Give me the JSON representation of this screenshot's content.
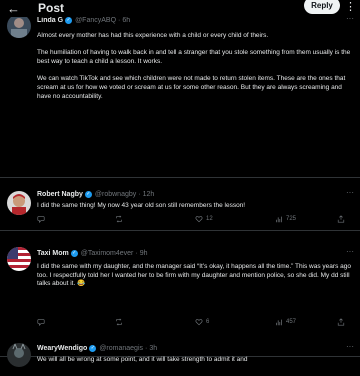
{
  "header": {
    "back_icon": "arrow-left-icon",
    "title": "Post",
    "reply_label": "Reply",
    "more_icon": "more-vertical-icon"
  },
  "posts": [
    {
      "name": "Linda G",
      "handle": "@FancyABQ",
      "time": "6h",
      "verified": true,
      "paragraphs": [
        "Almost every mother has had this experience with a child or every child of theirs.",
        "The humiliation of having to walk back in and tell a stranger that you stole something from them usually is the best way to teach a child a lesson. It works.",
        "We can watch TikTok and see which children were not made to return stolen items. These are the ones that scream at us for how we voted or scream at us for some other reason. But they are always screaming and have no accountability."
      ]
    },
    {
      "name": "Robert Nagby",
      "handle": "@robwnagby",
      "time": "12h",
      "verified": true,
      "paragraphs": [
        "I did the same thing! My now 43 year old son still remembers the lesson!"
      ],
      "actions": {
        "replies": "",
        "reposts": "",
        "likes": "12",
        "views": "725"
      }
    },
    {
      "name": "Taxi Mom",
      "handle": "@Taximom4ever",
      "time": "9h",
      "verified": true,
      "paragraphs": [
        "I did the same with my daughter, and the manager said “It’s okay, it happens all the time.” This was years ago too. I respectfully told her I wanted her to be firm with my daughter and mention police, so she did. My dd still talks about it. 😂"
      ],
      "actions": {
        "replies": "",
        "reposts": "",
        "likes": "6",
        "views": "457"
      }
    },
    {
      "name": "WearyWendigo",
      "handle": "@romanaegis",
      "time": "3h",
      "verified": true,
      "paragraphs": [
        "We will all be wrong at some point, and it will take strength to admit it and"
      ]
    }
  ],
  "colors": {
    "background": "#000000",
    "text": "#e7e9ea",
    "muted": "#71767b",
    "accent": "#1d9bf0",
    "divider": "#2f3336"
  }
}
